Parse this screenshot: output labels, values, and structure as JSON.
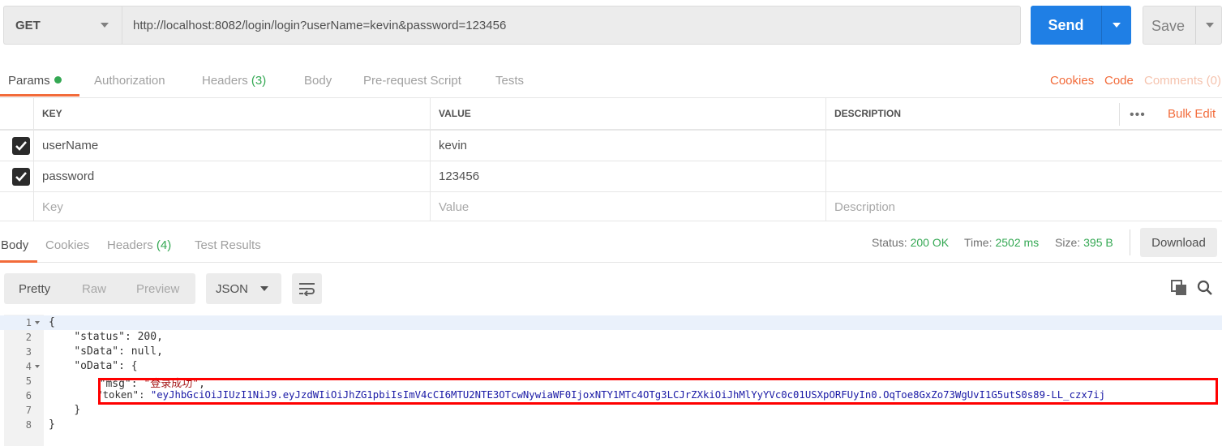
{
  "request": {
    "method": "GET",
    "url": "http://localhost:8082/login/login?userName=kevin&password=123456",
    "send_label": "Send",
    "save_label": "Save"
  },
  "request_tabs": {
    "params": "Params",
    "authorization": "Authorization",
    "headers": "Headers",
    "headers_count": "(3)",
    "body": "Body",
    "prerequest": "Pre-request Script",
    "tests": "Tests",
    "cookies": "Cookies",
    "code": "Code",
    "comments": "Comments (0)"
  },
  "params_table": {
    "columns": {
      "key": "KEY",
      "value": "VALUE",
      "description": "DESCRIPTION"
    },
    "more": "•••",
    "bulk_edit": "Bulk Edit",
    "rows": [
      {
        "checked": true,
        "key": "userName",
        "value": "kevin",
        "description": ""
      },
      {
        "checked": true,
        "key": "password",
        "value": "123456",
        "description": ""
      }
    ],
    "placeholders": {
      "key": "Key",
      "value": "Value",
      "description": "Description"
    }
  },
  "response_tabs": {
    "body": "Body",
    "cookies": "Cookies",
    "headers": "Headers",
    "headers_count": "(4)",
    "test_results": "Test Results"
  },
  "response_status": {
    "status_label": "Status:",
    "status_value": "200 OK",
    "time_label": "Time:",
    "time_value": "2502 ms",
    "size_label": "Size:",
    "size_value": "395 B",
    "download_label": "Download"
  },
  "response_toolbar": {
    "pretty": "Pretty",
    "raw": "Raw",
    "preview": "Preview",
    "format": "JSON"
  },
  "response_body": {
    "line_numbers": [
      "1",
      "2",
      "3",
      "4",
      "5",
      "6",
      "7",
      "8"
    ],
    "l1": "{",
    "l2_key": "\"status\"",
    "l2_val": "200",
    "l3_key": "\"sData\"",
    "l3_val": "null",
    "l4_key": "\"oData\"",
    "l4_val": "{",
    "l5_key": "\"msg\"",
    "l5_val": "\"登录成功\"",
    "l6_key": "\"token\"",
    "l6_val": "\"eyJhbGciOiJIUzI1NiJ9.eyJzdWIiOiJhZG1pbiIsImV4cCI6MTU2NTE3OTcwNywiaWF0IjoxNTY1MTc4OTg3LCJrZXkiOiJhMlYyYVc0c01USXpORFUyIn0.OqToe8GxZo73WgUvI1G5utS0s89-LL_czx7ij",
    "l7": "}",
    "l8": "}"
  },
  "colors": {
    "accent": "#f26b3a",
    "send_button": "#1f7fe5",
    "success": "#34a853",
    "highlight_box": "#ff0000"
  }
}
